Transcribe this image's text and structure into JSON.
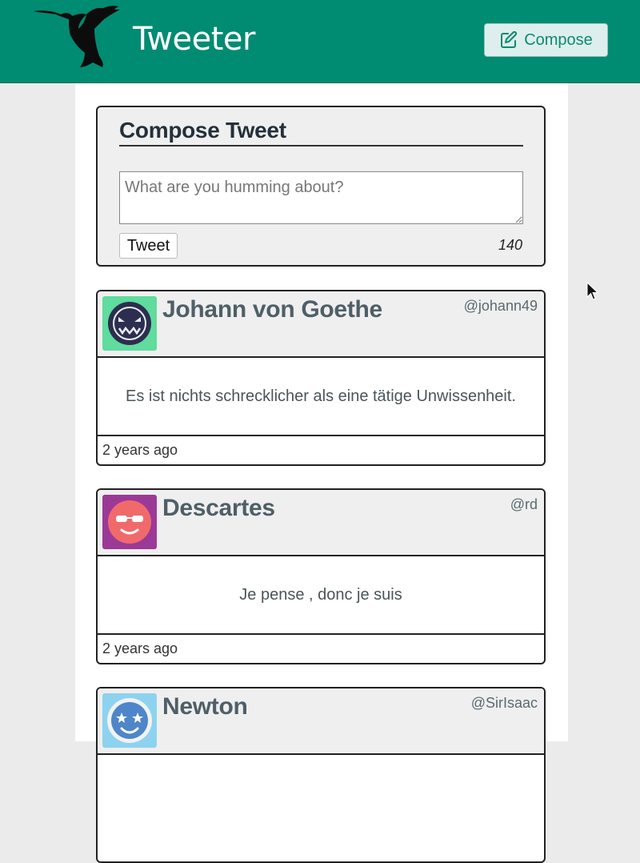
{
  "nav": {
    "brand": "Tweeter",
    "compose_label": "Compose"
  },
  "compose": {
    "title": "Compose Tweet",
    "placeholder": "What are you humming about?",
    "tweet_label": "Tweet",
    "counter": "140"
  },
  "tweets": [
    {
      "name": "Johann von Goethe",
      "handle": "@johann49",
      "text": "Es ist nichts schrecklicher als eine tätige Unwissenheit.",
      "time": "2 years ago",
      "avatar_bg": "#5fdc9e"
    },
    {
      "name": "Descartes",
      "handle": "@rd",
      "text": "Je pense , donc je suis",
      "time": "2 years ago",
      "avatar_bg": "#9b3a96"
    },
    {
      "name": "Newton",
      "handle": "@SirIsaac",
      "avatar_bg": "#8dd3ef"
    }
  ],
  "colors": {
    "nav_bg": "#008c72",
    "accent": "#0e8a6f"
  }
}
